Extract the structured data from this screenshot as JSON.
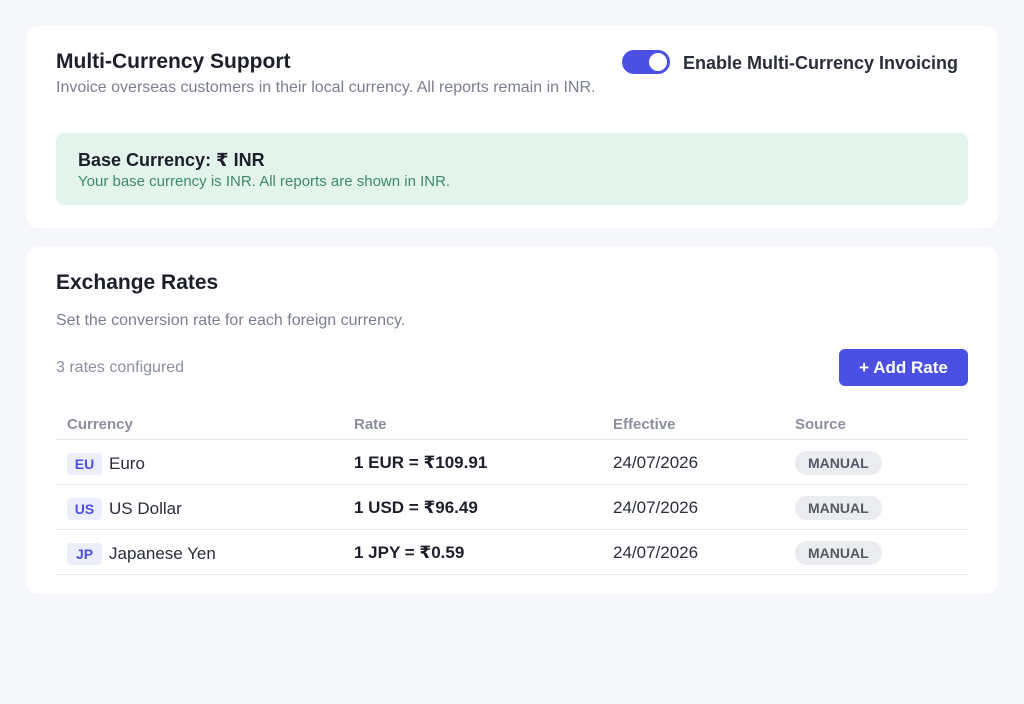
{
  "multi_currency": {
    "title": "Multi-Currency Support",
    "description": "Invoice overseas customers in their local currency. All reports remain in INR.",
    "toggle_label": "Enable Multi-Currency Invoicing",
    "toggle_enabled": true,
    "base": {
      "title": "Base Currency: ₹ INR",
      "description": "Your base currency is INR. All reports are shown in INR."
    }
  },
  "exchange_rates": {
    "title": "Exchange Rates",
    "description": "Set the conversion rate for each foreign currency.",
    "count_text": "3 rates configured",
    "add_button": "+ Add Rate",
    "columns": [
      "Currency",
      "Rate",
      "Effective",
      "Source"
    ],
    "rows": [
      {
        "code": "EU",
        "name": "Euro",
        "rate": "1 EUR = ₹109.91",
        "effective": "24/07/2026",
        "source": "MANUAL"
      },
      {
        "code": "US",
        "name": "US Dollar",
        "rate": "1 USD = ₹96.49",
        "effective": "24/07/2026",
        "source": "MANUAL"
      },
      {
        "code": "JP",
        "name": "Japanese Yen",
        "rate": "1 JPY = ₹0.59",
        "effective": "24/07/2026",
        "source": "MANUAL"
      }
    ]
  },
  "colors": {
    "accent": "#4b4fe2",
    "page_bg": "#f6f7fb",
    "success_bg": "#e3f4ec",
    "success_text": "#3f8a66"
  }
}
